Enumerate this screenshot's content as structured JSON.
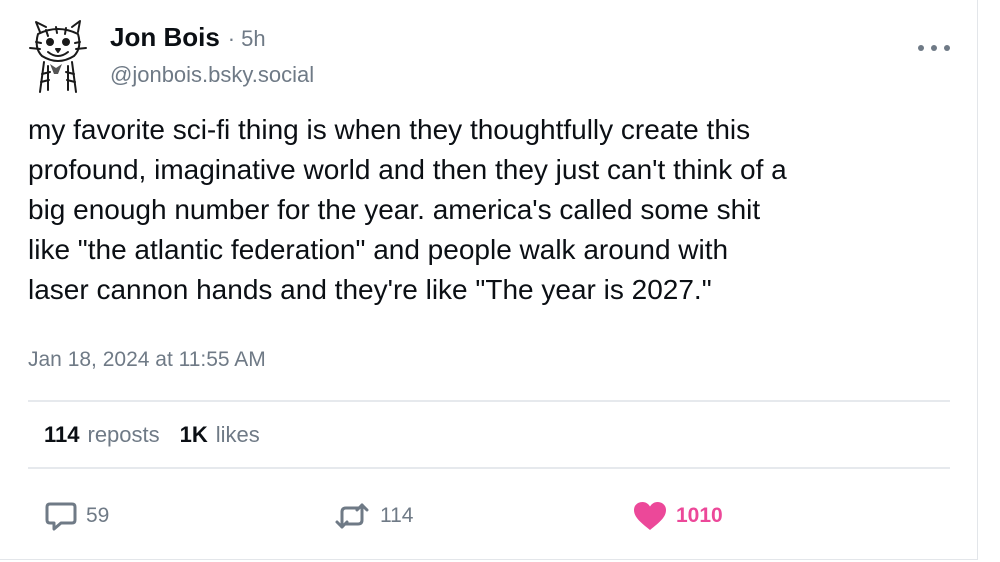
{
  "post": {
    "author_name": "Jon Bois",
    "separator": "·",
    "time_ago": "5h",
    "handle": "@jonbois.bsky.social",
    "text": "my favorite sci-fi thing is when they thoughtfully create this\nprofound, imaginative world and then they just can't think of a\nbig enough number for the year. america's called some shit\nlike \"the atlantic federation\" and people walk around with\nlaser cannon hands and they're like \"The year is 2027.\"",
    "timestamp": "Jan 18, 2024 at 11:55 AM"
  },
  "stats": {
    "reposts_count": "114",
    "reposts_label": "reposts",
    "likes_count": "1K",
    "likes_label": "likes"
  },
  "actions": {
    "reply_count": "59",
    "repost_count": "114",
    "like_count": "1010",
    "liked": true
  },
  "colors": {
    "text": "#0b0f14",
    "muted": "#6f7a86",
    "like": "#ec4899",
    "divider": "#e6e9ed"
  },
  "icons": {
    "avatar": "tiger-avatar",
    "more": "more-options-icon",
    "reply": "reply-icon",
    "repost": "repost-icon",
    "like": "heart-icon"
  }
}
